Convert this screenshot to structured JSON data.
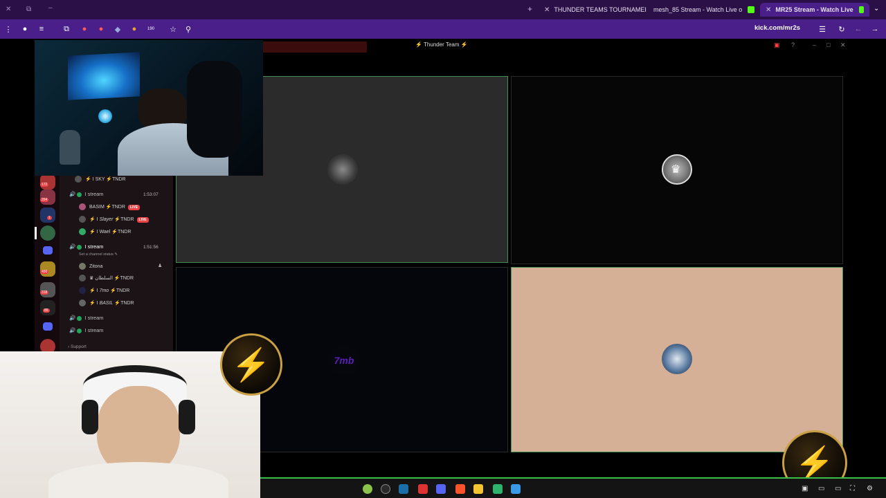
{
  "browser": {
    "tabs": [
      {
        "title": "THUNDER TEAMS TOURNAMEI",
        "favicon_color": "#22a847"
      },
      {
        "title": "mesh_85 Stream - Watch Live o",
        "favicon_color": "#53fc18"
      },
      {
        "title": "MR25 Stream - Watch Live",
        "favicon_color": "#53fc18",
        "active": true
      }
    ],
    "new_tab_label": "+",
    "url": "kick.com/mr2s",
    "extension_badge": "190"
  },
  "discord": {
    "window_title": "Thunder Team",
    "tiles": [
      {
        "label": "",
        "bg": "#2b2b2b"
      },
      {
        "label": "",
        "bg": "#060606"
      },
      {
        "label": "7mb",
        "bg": "#05060c"
      },
      {
        "label": "",
        "bg": "#d5af96"
      }
    ],
    "server_badges": [
      "172",
      "264",
      "1",
      "450",
      "318",
      "85"
    ],
    "channels": [
      {
        "type": "member",
        "name": "SKY",
        "tag": "TNDR"
      },
      {
        "type": "voice",
        "name": "stream",
        "time": "1:53:07"
      },
      {
        "type": "member",
        "name": "BASIM",
        "tag": "TNDR",
        "live": "LIVE"
      },
      {
        "type": "member",
        "name": "Slayer",
        "tag": "TNDR",
        "live": "LIVE"
      },
      {
        "type": "member",
        "name": "Wael",
        "tag": "TNDR"
      },
      {
        "type": "voice",
        "name": "stream",
        "time": "1:51:56"
      },
      {
        "type": "status",
        "name": "Set a channel status"
      },
      {
        "type": "member",
        "name": "Zitona"
      },
      {
        "type": "member",
        "name": "السلطان",
        "tag": "TNDR"
      },
      {
        "type": "member",
        "name": "7mo",
        "tag": "TNDR"
      },
      {
        "type": "member",
        "name": "BASIL",
        "tag": "TNDR"
      },
      {
        "type": "voice",
        "name": "stream"
      },
      {
        "type": "voice",
        "name": "stream"
      },
      {
        "type": "category",
        "name": "Support"
      }
    ]
  },
  "taskbar": {
    "apps": [
      "green-app",
      "steam",
      "steam-alt",
      "app-red",
      "discord",
      "brave",
      "files",
      "green-square",
      "windows"
    ]
  }
}
